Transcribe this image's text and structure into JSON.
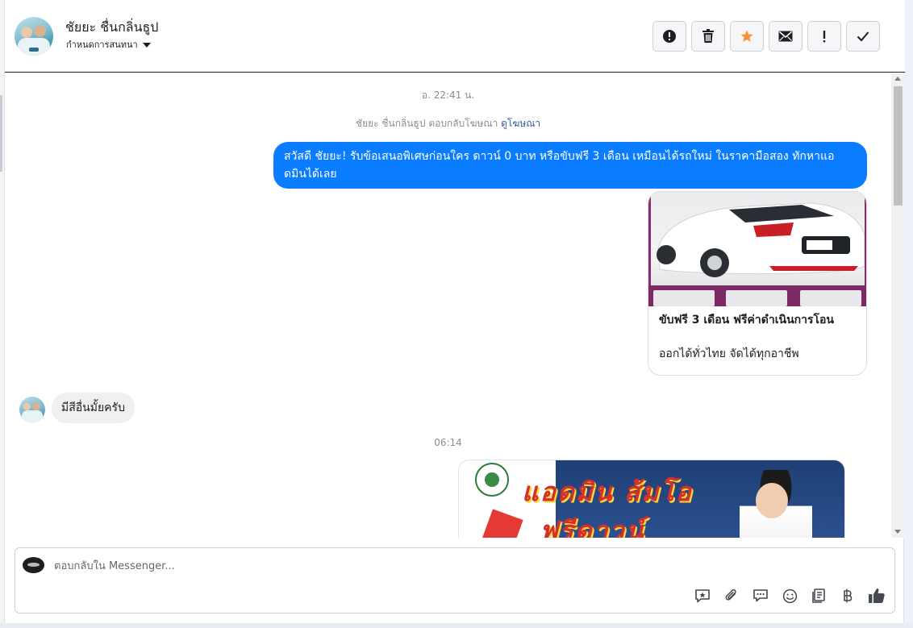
{
  "header": {
    "name": "ชัยยะ ชื่นกลิ่นธูป",
    "subtitle": "กำหนดการสนทนา",
    "toolbar": [
      {
        "name": "mark-spam-button",
        "icon": "alert-circle-icon"
      },
      {
        "name": "delete-button",
        "icon": "trash-icon"
      },
      {
        "name": "star-button",
        "icon": "star-icon"
      },
      {
        "name": "mark-unread-button",
        "icon": "envelope-icon"
      },
      {
        "name": "follow-up-button",
        "icon": "exclamation-icon"
      },
      {
        "name": "mark-done-button",
        "icon": "check-icon"
      }
    ]
  },
  "conversation": {
    "timestamp_1": "อ. 22:41 น.",
    "ad_note_prefix": "ชัยยะ ชื่นกลิ่นธูป ตอบกลับโฆษณา",
    "ad_note_link": "ดูโฆษณา",
    "outgoing_message": "สวัสดี ชัยยะ! รับข้อเสนอพิเศษก่อนใคร ดาวน์ 0 บาท หรือขับฟรี 3 เดือน เหมือนได้รถใหม่ ในราคามือสอง ทักหาแอดมินได้เลย",
    "card": {
      "title": "ขับฟรี 3 เดือน ฟรีค่าดำเนินการโอน",
      "description": "ออกได้ทั่วไทย จัดได้ทุกอาชีพ"
    },
    "incoming_message": "มีสีอื่นมั้ยครับ",
    "timestamp_2": "06:14",
    "promo_image": {
      "line1": "แอดมิน ส้มโอ",
      "line2": "ฟรีดาวน์"
    }
  },
  "composer": {
    "placeholder": "ตอบกลับใน Messenger...",
    "tools": [
      "saved-reply-icon",
      "paperclip-icon",
      "chat-bubbles-icon",
      "emoji-icon",
      "catalog-icon",
      "baht-icon",
      "thumbs-up-icon"
    ]
  },
  "colors": {
    "outgoing_bubble": "#0a7cff",
    "incoming_bubble": "#f0f0f0",
    "star": "#f7923a",
    "link": "#385898"
  }
}
